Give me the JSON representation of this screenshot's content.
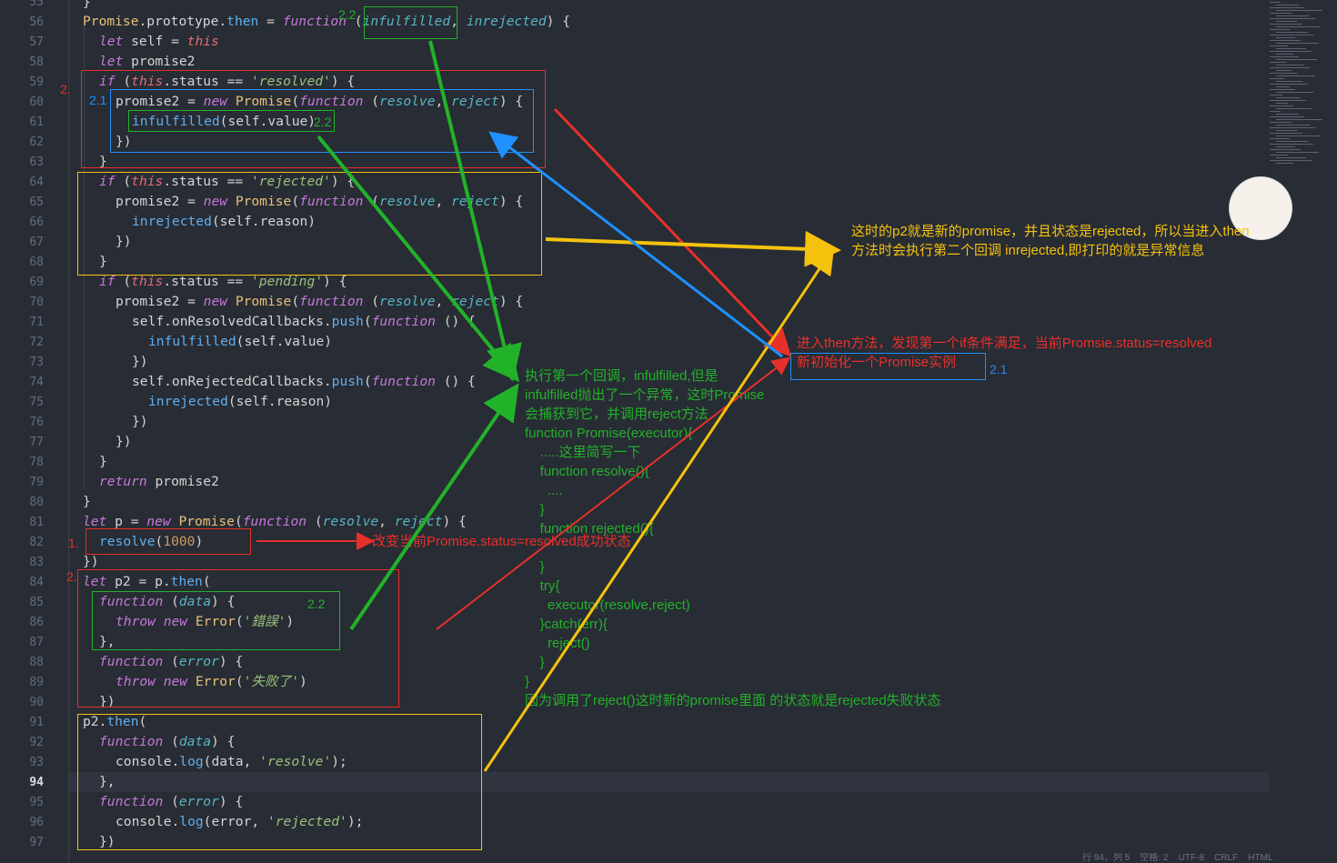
{
  "editor": {
    "active_line": "94",
    "line_numbers": [
      "55",
      "56",
      "57",
      "58",
      "59",
      "60",
      "61",
      "62",
      "63",
      "64",
      "65",
      "66",
      "67",
      "68",
      "69",
      "70",
      "71",
      "72",
      "73",
      "74",
      "75",
      "76",
      "77",
      "78",
      "79",
      "80",
      "81",
      "82",
      "83",
      "84",
      "85",
      "86",
      "87",
      "88",
      "89",
      "90",
      "91",
      "92",
      "93",
      "94",
      "95",
      "96",
      "97"
    ],
    "code": {
      "l55": "}",
      "l56": {
        "a": "Promise",
        "b": ".prototype.",
        "c": "then",
        "d": " = ",
        "e": "function",
        "f": " (",
        "g": "infulfilled",
        ",": ", ",
        "h": "inrejected",
        "i": ") {"
      },
      "l57": {
        "a": "let",
        "b": " self = ",
        "c": "this"
      },
      "l58": {
        "a": "let",
        "b": " promise2"
      },
      "l59": {
        "a": "if",
        "b": " (",
        "c": "this",
        "d": ".status == ",
        "e": "'resolved'",
        "f": ") {"
      },
      "l60": {
        "a": "promise2 = ",
        "b": "new",
        "c": " ",
        "d": "Promise",
        "e": "(",
        "f": "function",
        "g": " (",
        "h": "resolve",
        ",": ", ",
        "i": "reject",
        "j": ") {"
      },
      "l61": {
        "a": "infulfilled",
        "b": "(self.value)"
      },
      "l62": "})",
      "l63": "}",
      "l64": {
        "a": "if",
        "b": " (",
        "c": "this",
        "d": ".status == ",
        "e": "'rejected'",
        "f": ") {"
      },
      "l65": {
        "a": "promise2 = ",
        "b": "new",
        "c": " ",
        "d": "Promise",
        "e": "(",
        "f": "function",
        "g": " (",
        "h": "resolve",
        ",": ", ",
        "i": "reject",
        "j": ") {"
      },
      "l66": {
        "a": "inrejected",
        "b": "(self.reason)"
      },
      "l67": "})",
      "l68": "}",
      "l69": {
        "a": "if",
        "b": " (",
        "c": "this",
        "d": ".status == ",
        "e": "'pending'",
        "f": ") {"
      },
      "l70": {
        "a": "promise2 = ",
        "b": "new",
        "c": " ",
        "d": "Promise",
        "e": "(",
        "f": "function",
        "g": " (",
        "h": "resolve",
        ",": ", ",
        "i": "reject",
        "j": ") {"
      },
      "l71": {
        "a": "self.onResolvedCallbacks.",
        "b": "push",
        "c": "(",
        "d": "function",
        "e": " () {"
      },
      "l72": {
        "a": "infulfilled",
        "b": "(self.value)"
      },
      "l73": "})",
      "l74": {
        "a": "self.onRejectedCallbacks.",
        "b": "push",
        "c": "(",
        "d": "function",
        "e": " () {"
      },
      "l75": {
        "a": "inrejected",
        "b": "(self.reason)"
      },
      "l76": "})",
      "l77": "})",
      "l78": "}",
      "l79": {
        "a": "return",
        "b": " promise2"
      },
      "l80": "}",
      "l81": {
        "a": "let",
        "b": " p = ",
        "c": "new",
        "d": " ",
        "e": "Promise",
        "f": "(",
        "g": "function",
        "h": " (",
        "i": "resolve",
        ",": ", ",
        "j": "reject",
        "k": ") {"
      },
      "l82": {
        "a": "resolve",
        "b": "(",
        "c": "1000",
        "d": ")"
      },
      "l83": "})",
      "l84": {
        "a": "let",
        "b": " p2 = p.",
        "c": "then",
        "d": "("
      },
      "l85": {
        "a": "function",
        "b": " (",
        "c": "data",
        "d": ") {"
      },
      "l86": {
        "a": "throw",
        "b": " ",
        "c": "new",
        "d": " ",
        "e": "Error",
        "f": "(",
        "g": "'錯誤'",
        "h": ")"
      },
      "l87": "},",
      "l88": {
        "a": "function",
        "b": " (",
        "c": "error",
        "d": ") {"
      },
      "l89": {
        "a": "throw",
        "b": " ",
        "c": "new",
        "d": " ",
        "e": "Error",
        "f": "(",
        "g": "'失败了'",
        "h": ")"
      },
      "l90": "})",
      "l91": {
        "a": "p2.",
        "b": "then",
        "c": "("
      },
      "l92": {
        "a": "function",
        "b": " (",
        "c": "data",
        "d": ") {"
      },
      "l93": {
        "a": "console.",
        "b": "log",
        "c": "(data, ",
        "d": "'resolve'",
        "e": ");"
      },
      "l94": "},",
      "l95": {
        "a": "function",
        "b": " (",
        "c": "error",
        "d": ") {"
      },
      "l96": {
        "a": "console.",
        "b": "log",
        "c": "(error, ",
        "d": "'rejected'",
        "e": ");"
      },
      "l97": "})"
    }
  },
  "annotations": {
    "labels": {
      "top_2_2": "2.2",
      "inner_2_2": "2.2",
      "step_2_top": "2.",
      "step_2_1": "2.1",
      "step_1": "1.",
      "step_2_bottom": "2.",
      "box_2_2_bottom": "2.2",
      "red_note_2_1": "2.1"
    },
    "yellow_note": "这时的p2就是新的promise，并且状态是rejected，所以当进入then\n方法时会执行第二个回调 inrejected,即打印的就是异常信息",
    "red_note_line1": "进入then方法，发现第一个if条件满足，当前Promsie.status=resolved",
    "red_note_line2": "新初始化一个Promise实例",
    "green_note": "执行第一个回调，infulfilled,但是\ninfulfilled抛出了一个异常，这时Promise\n会捕获到它，并调用reject方法\nfunction Promise(executor){\n    .....这里简写一下\n    function resolve(){\n      ....\n    }\n    function rejected(){\n\n    }\n    try{\n      executor(resolve,reject)\n    }catch(err){\n      reject()\n    }\n}\n因为调用了reject()这时新的promise里面 的状态就是rejected失败状态",
    "resolve_note": "改变当前Promise.status=resolved成功状态"
  },
  "status_bar": "行 94，列 5    空格: 2    UTF-8    CRLF    HTML",
  "colors": {
    "background": "#282c34",
    "red": "#e8302b",
    "green": "#22b22a",
    "yellow": "#f4c20d",
    "blue": "#1e90ff"
  }
}
